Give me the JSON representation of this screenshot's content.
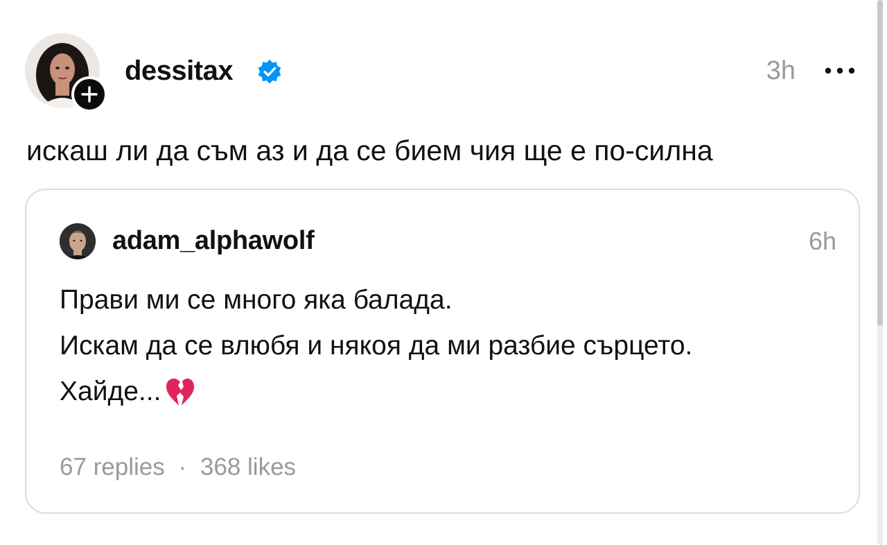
{
  "post": {
    "author": "dessitax",
    "verified": true,
    "time": "3h",
    "text": "искаш ли да съм аз и да се бием чия ще е по-силна"
  },
  "quoted_post": {
    "author": "adam_alphawolf",
    "time": "6h",
    "lines": [
      "Прави ми се много яка балада.",
      "Искам да се влюбя и някоя да ми разбие сърцето.",
      "Хайде..."
    ],
    "emoji": "broken-heart-icon",
    "replies": "67 replies",
    "separator": "·",
    "likes": "368 likes"
  },
  "colors": {
    "text": "#111111",
    "muted": "#9a9a9a",
    "verified_blue": "#0095f6",
    "card_border": "#dcdcdc",
    "broken_heart": "#e0245e"
  }
}
